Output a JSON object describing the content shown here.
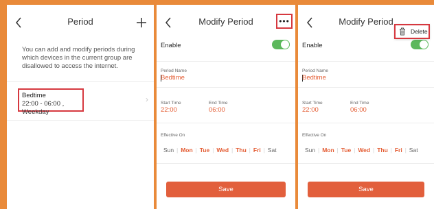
{
  "screens": [
    {
      "title": "Period",
      "description": "You can add and modify periods during which devices in the current group are disallowed to access the internet.",
      "period_item": {
        "name": "Bedtime",
        "time": "22:00 - 06:00 , Weekday"
      }
    },
    {
      "title": "Modify Period",
      "enable_label": "Enable",
      "period_name_label": "Period Name",
      "period_name_value": "Bedtime",
      "start_time_label": "Start Time",
      "start_time_value": "22:00",
      "end_time_label": "End Time",
      "end_time_value": "06:00",
      "effective_on_label": "Effective On",
      "save_label": "Save",
      "more_label": "•••"
    },
    {
      "title": "Modify Period",
      "enable_label": "Enable",
      "period_name_label": "Period Name",
      "period_name_value": "Bedtime",
      "start_time_label": "Start Time",
      "start_time_value": "22:00",
      "end_time_label": "End Time",
      "end_time_value": "06:00",
      "effective_on_label": "Effective On",
      "save_label": "Save",
      "delete_label": "Delete"
    }
  ],
  "days": [
    {
      "label": "Sun",
      "selected": false
    },
    {
      "label": "Mon",
      "selected": true
    },
    {
      "label": "Tue",
      "selected": true
    },
    {
      "label": "Wed",
      "selected": true
    },
    {
      "label": "Thu",
      "selected": true
    },
    {
      "label": "Fri",
      "selected": true
    },
    {
      "label": "Sat",
      "selected": false
    }
  ],
  "colors": {
    "frame": "#e98a3a",
    "accent": "#e45d34",
    "toggle_on": "#5cb85c",
    "highlight_box": "#d6383f"
  },
  "icons": [
    "back-arrow-icon",
    "plus-icon",
    "more-dots-icon",
    "chevron-right-icon",
    "trash-icon"
  ],
  "enable_toggle_on": true
}
